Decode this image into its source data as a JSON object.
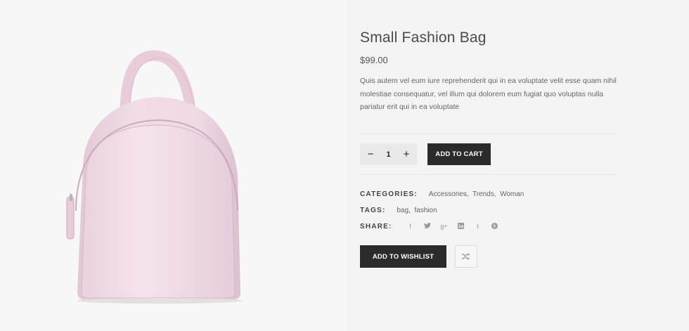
{
  "product": {
    "title": "Small Fashion Bag",
    "price": "$99.00",
    "description": "Quis autem vel eum iure reprehenderit qui in ea voluptate velit esse quam nihil molestiae consequatur, vel illum qui dolorem eum fugiat quo voluptas nulla pariatur erit qui in ea voluptate",
    "image_icon": "backpack-product-image",
    "image_color": "#f0dbe6"
  },
  "cart": {
    "quantity": "1",
    "decrease_symbol": "−",
    "increase_symbol": "+",
    "add_label": "ADD TO CART"
  },
  "meta": {
    "categories_label": "CATEGORIES:",
    "categories": [
      "Accessories,",
      "Trends,",
      "Woman"
    ],
    "tags_label": "TAGS:",
    "tags": [
      "bag,",
      "fashion"
    ],
    "share_label": "SHARE:",
    "share_icons": [
      "facebook-icon",
      "twitter-icon",
      "google-plus-icon",
      "linkedin-icon",
      "tumblr-icon",
      "pinterest-icon"
    ]
  },
  "actions": {
    "wishlist_label": "ADD TO WISHLIST",
    "compare_icon": "shuffle-icon"
  },
  "colors": {
    "dark_button": "#2b2b2b",
    "qty_bg": "#e9e9e9"
  }
}
